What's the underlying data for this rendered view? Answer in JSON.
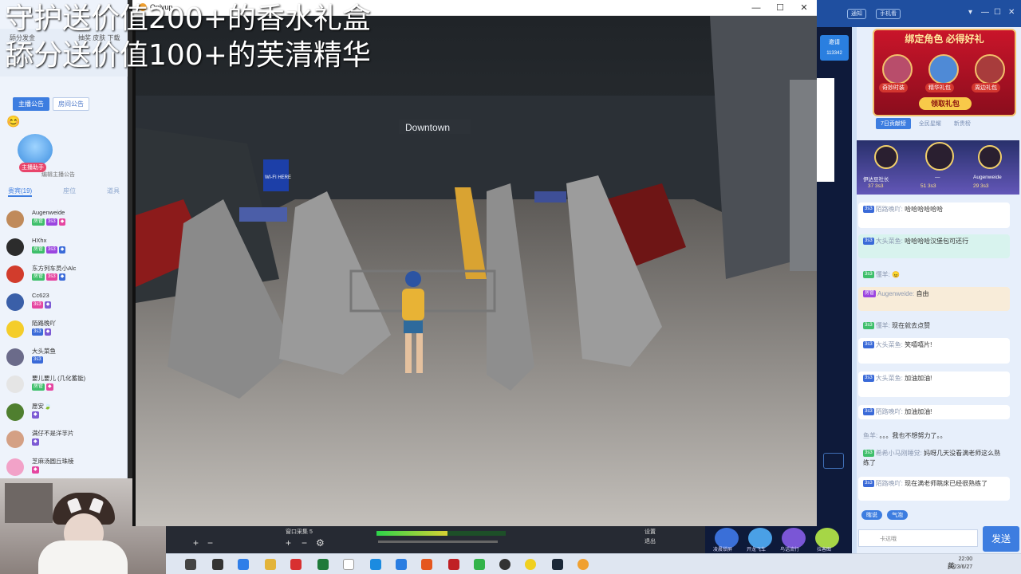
{
  "overlay": {
    "line1": "守护送价值200+的香水礼盒",
    "line2": "舔分送价值100+的芙清精华"
  },
  "left_panel": {
    "header_small_1": "舔分发金",
    "header_small_2": "抽奖 皮肤 下载",
    "announce_tabs": [
      "主播公告",
      "房间公告"
    ],
    "assistant_tag": "主播助手",
    "assistant_sub": "编辑主播公告",
    "list_tabs": [
      "贵宾(19)",
      "座位",
      "道具"
    ],
    "users": [
      {
        "name": "Augenweide",
        "avatar_color": "#c08a5a"
      },
      {
        "name": "HXhx",
        "avatar_color": "#2c2c2c"
      },
      {
        "name": "东方列车员小Alc",
        "avatar_color": "#d23c2c"
      },
      {
        "name": "Cc623",
        "avatar_color": "#3a5fa8"
      },
      {
        "name": "陌路晚吖",
        "avatar_color": "#f4cd2a"
      },
      {
        "name": "大头菜鱼",
        "avatar_color": "#6b6b8a"
      },
      {
        "name": "要儿要儿 (几化蓄能)",
        "avatar_color": "#e5e5e5"
      },
      {
        "name": "愿安🍃",
        "avatar_color": "#4f7f2f"
      },
      {
        "name": "满仔不是洋芋片",
        "avatar_color": "#d4a084"
      },
      {
        "name": "芝麻汤圆丘珠棱",
        "avatar_color": "#f2a2c8"
      }
    ]
  },
  "game_window": {
    "title": "Onlyup",
    "controls": [
      "—",
      "☐",
      "✕"
    ],
    "sign_text": "Downtown",
    "wifi_text": "WI-FI HERE"
  },
  "right_panel": {
    "topbar": {
      "pill1": "通知",
      "pill2": "手机看",
      "controls": [
        "▾",
        "—",
        "☐",
        "✕"
      ]
    },
    "invite_label": "邀请",
    "invite_id": "113342",
    "promo": {
      "headline": "绑定角色 必得好礼",
      "gifts": [
        "奇妙时装",
        "精华礼包",
        "周边礼包"
      ],
      "claim": "领取礼包"
    },
    "rank_tabs": [
      "7日贡献榜",
      "全民星耀",
      "新贵榜"
    ],
    "rank": [
      {
        "name": "伊达豆社长",
        "score": "37 3s3"
      },
      {
        "name": "—",
        "score": "51 3s3"
      },
      {
        "name": "Augenweide",
        "score": "29 3s3"
      }
    ],
    "messages": [
      {
        "who": "陌路晚吖:",
        "text": "哈哈哈哈哈哈"
      },
      {
        "who": "大头菜鱼:",
        "text": "哈哈哈哈汉堡包可还行"
      },
      {
        "who": "懂羊:",
        "text": "😠"
      },
      {
        "who": "Augenweide:",
        "text": "自由"
      },
      {
        "who": "懂羊:",
        "text": "现在就去点赞"
      },
      {
        "who": "大头菜鱼:",
        "text": "笑嘻嘻片!"
      },
      {
        "who": "大头菜鱼:",
        "text": "加油加油!"
      },
      {
        "who": "陌路晚吖:",
        "text": "加油加油!"
      },
      {
        "who": "鱼羊:",
        "text": "。。。我也不想努力了。。"
      },
      {
        "who": "希希小马刚睡觉:",
        "text": "妈呀几天没看满老师这么熟练了"
      },
      {
        "who": "陌路晚吖:",
        "text": "现在满老师跳床已经很熟练了"
      }
    ],
    "chips": [
      "瞎说",
      "气泡"
    ],
    "input_placeholder": "卡达哦",
    "send_label": "发送",
    "bottom_gifts": [
      "凌晨锁屏",
      "开龙飞车",
      "鸟话流行",
      "拉客图"
    ]
  },
  "obs": {
    "source_label": "窗口采集 5",
    "right_label_1": "设置",
    "right_label_2": "退出"
  },
  "taskbar": {
    "tray_text": "英",
    "time": "22:00",
    "date": "2023/6/27"
  }
}
